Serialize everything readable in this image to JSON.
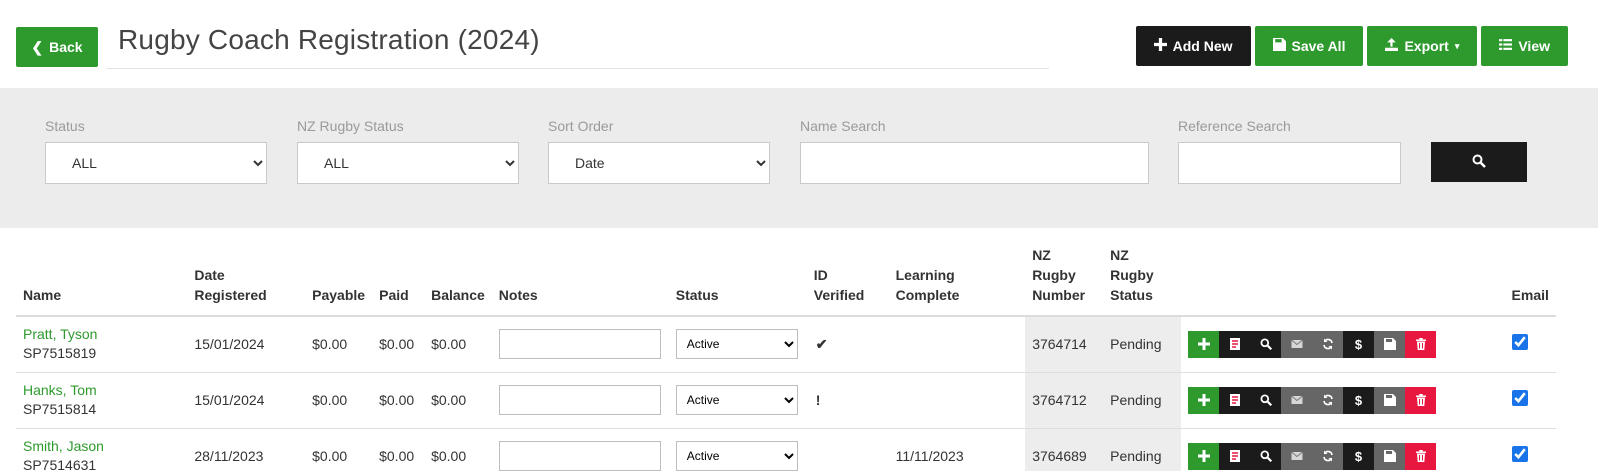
{
  "header": {
    "back_label": "Back",
    "title": "Rugby Coach Registration (2024)",
    "add_new_label": "Add New",
    "save_all_label": "Save All",
    "export_label": "Export",
    "view_label": "View"
  },
  "filters": {
    "status": {
      "label": "Status",
      "value": "ALL"
    },
    "nz_rugby_status": {
      "label": "NZ Rugby Status",
      "value": "ALL"
    },
    "sort_order": {
      "label": "Sort Order",
      "value": "Date"
    },
    "name_search": {
      "label": "Name Search",
      "value": ""
    },
    "reference_search": {
      "label": "Reference Search",
      "value": ""
    }
  },
  "table": {
    "headers": {
      "name": "Name",
      "date_registered": "Date Registered",
      "payable": "Payable",
      "paid": "Paid",
      "balance": "Balance",
      "notes": "Notes",
      "status": "Status",
      "id_verified": "ID Verified",
      "learning_complete": "Learning Complete",
      "nz_rugby_number_1": "NZ Rugby",
      "nz_rugby_number_2": "Number",
      "nz_rugby_status_1": "NZ Rugby",
      "nz_rugby_status_2": "Status",
      "email": "Email"
    },
    "rows": [
      {
        "name": "Pratt, Tyson",
        "ref": "SP7515819",
        "date_registered": "15/01/2024",
        "payable": "$0.00",
        "paid": "$0.00",
        "balance": "$0.00",
        "notes": "",
        "status": "Active",
        "id_verified": "✔",
        "learning_complete": "",
        "nz_rugby_number": "3764714",
        "nz_rugby_status": "Pending",
        "email": true
      },
      {
        "name": "Hanks, Tom",
        "ref": "SP7515814",
        "date_registered": "15/01/2024",
        "payable": "$0.00",
        "paid": "$0.00",
        "balance": "$0.00",
        "notes": "",
        "status": "Active",
        "id_verified": "!",
        "learning_complete": "",
        "nz_rugby_number": "3764712",
        "nz_rugby_status": "Pending",
        "email": true
      },
      {
        "name": "Smith, Jason",
        "ref": "SP7514631",
        "date_registered": "28/11/2023",
        "payable": "$0.00",
        "paid": "$0.00",
        "balance": "$0.00",
        "notes": "",
        "status": "Active",
        "id_verified": "",
        "learning_complete": "11/11/2023",
        "nz_rugby_number": "3764689",
        "nz_rugby_status": "Pending",
        "email": true
      }
    ],
    "row_actions": [
      {
        "icon": "plus-icon",
        "style": "green"
      },
      {
        "icon": "pdf-icon",
        "style": "black"
      },
      {
        "icon": "search-icon",
        "style": "black"
      },
      {
        "icon": "envelope-icon",
        "style": "gray"
      },
      {
        "icon": "refresh-icon",
        "style": "gray"
      },
      {
        "icon": "dollar-icon",
        "style": "black"
      },
      {
        "icon": "save-icon",
        "style": "gray"
      },
      {
        "icon": "trash-icon",
        "style": "red"
      }
    ]
  },
  "colors": {
    "primary_green": "#2e9a2e",
    "dark": "#1b1b1b",
    "danger_red": "#e8173f",
    "filter_bg": "#ececec"
  }
}
